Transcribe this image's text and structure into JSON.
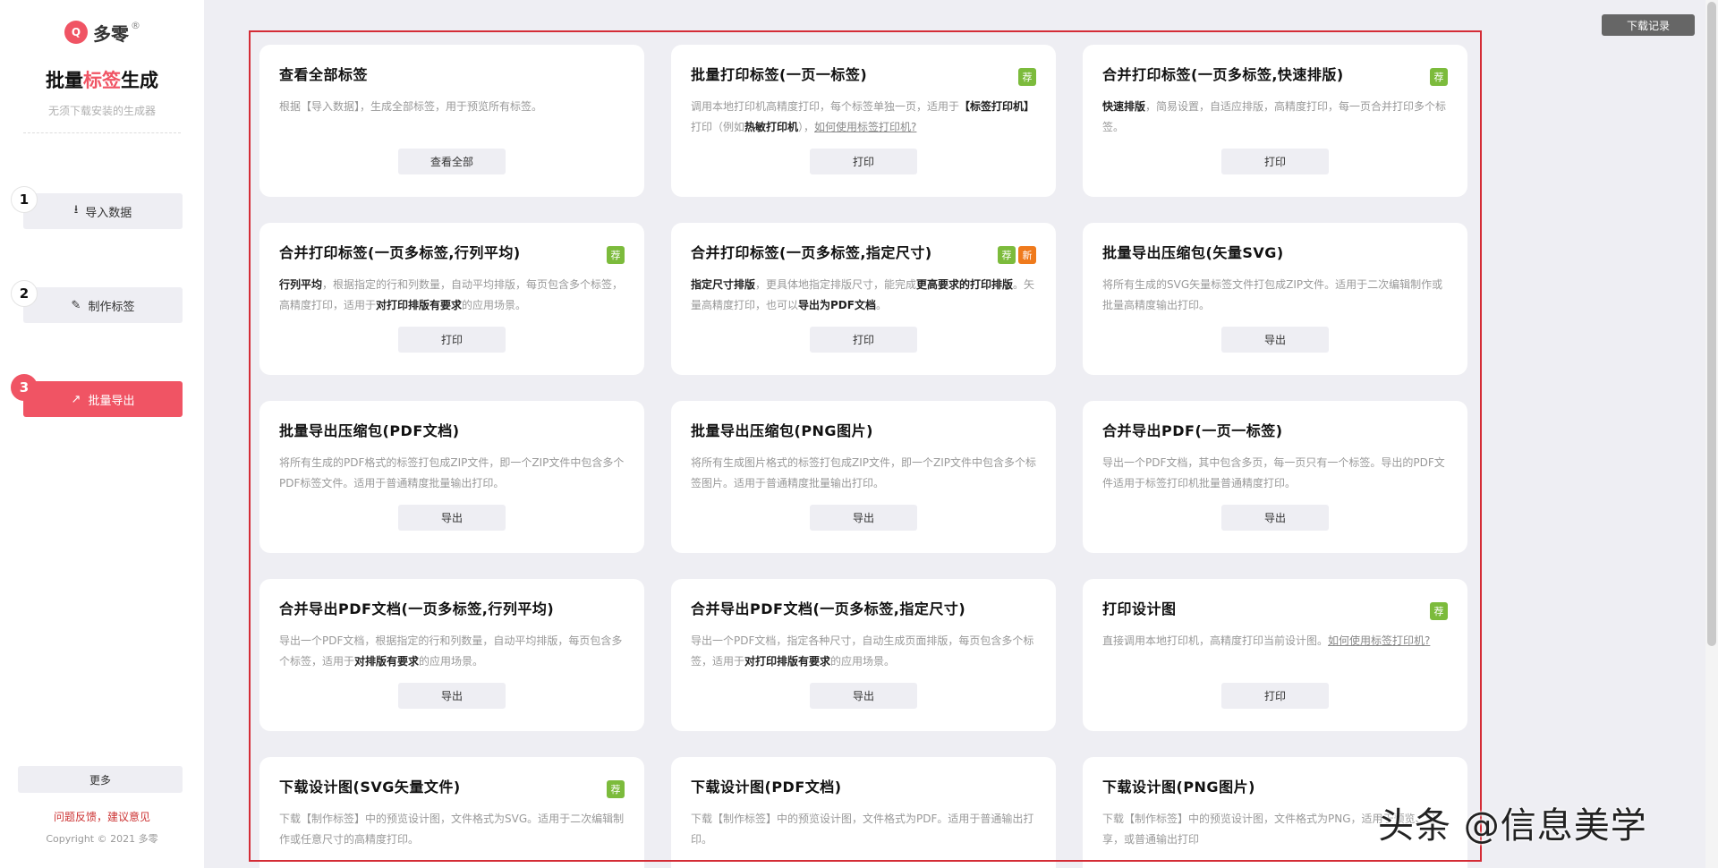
{
  "sidebar": {
    "logo_mark": "Q",
    "logo_text": "多零",
    "logo_reg": "®",
    "title_a": "批量",
    "title_b": "标签",
    "title_c": "生成",
    "subtitle": "无须下载安装的生成器",
    "steps": [
      {
        "num": "1",
        "label": "导入数据",
        "icon": "download-icon"
      },
      {
        "num": "2",
        "label": "制作标签",
        "icon": "edit-icon"
      },
      {
        "num": "3",
        "label": "批量导出",
        "icon": "export-icon",
        "active": true
      }
    ],
    "more": "更多",
    "feedback": "问题反馈，建议意见",
    "copyright": "Copyright © 2021 多零"
  },
  "header": {
    "download_records": "下载记录"
  },
  "colors": {
    "accent": "#f05464",
    "recommend": "#7cbb3c",
    "new": "#ef7a1c",
    "frame": "#d42c36"
  },
  "cards": [
    {
      "title": "查看全部标签",
      "badges": [],
      "desc": "根据【导入数据】，生成全部标签，用于预览所有标签。",
      "button": "查看全部"
    },
    {
      "title": "批量打印标签(一页一标签)",
      "badges": [
        "荐"
      ],
      "desc_html": [
        "调用本地打印机高精度打印，每个标签单独一页，适用于",
        "【标签打印机】",
        "打印（例如",
        "热敏打印机",
        "），",
        "如何使用标签打印机?"
      ],
      "button": "打印"
    },
    {
      "title": "合并打印标签(一页多标签,快速排版)",
      "badges": [
        "荐"
      ],
      "desc_parts": [
        "快速排版",
        "，简易设置，自适应排版，高精度打印，每一页合并打印多个标签。"
      ],
      "button": "打印"
    },
    {
      "title": "合并打印标签(一页多标签,行列平均)",
      "badges": [
        "荐"
      ],
      "desc_parts": [
        "行列平均",
        "，根据指定的行和列数量，自动平均排版，每页包含多个标签，高精度打印，适用于",
        "对打印排版有要求",
        "的应用场景。"
      ],
      "button": "打印"
    },
    {
      "title": "合并打印标签(一页多标签,指定尺寸)",
      "badges": [
        "荐",
        "新"
      ],
      "desc_parts": [
        "指定尺寸排版",
        "，更具体地指定排版尺寸，能完成",
        "更高要求的打印排版",
        "。矢量高精度打印，也可以",
        "导出为PDF文档",
        "。"
      ],
      "button": "打印"
    },
    {
      "title": "批量导出压缩包(矢量SVG)",
      "badges": [],
      "desc": "将所有生成的SVG矢量标签文件打包成ZIP文件。适用于二次编辑制作或批量高精度输出打印。",
      "button": "导出"
    },
    {
      "title": "批量导出压缩包(PDF文档)",
      "badges": [],
      "desc": "将所有生成的PDF格式的标签打包成ZIP文件，即一个ZIP文件中包含多个PDF标签文件。适用于普通精度批量输出打印。",
      "button": "导出"
    },
    {
      "title": "批量导出压缩包(PNG图片)",
      "badges": [],
      "desc": "将所有生成图片格式的标签打包成ZIP文件，即一个ZIP文件中包含多个标签图片。适用于普通精度批量输出打印。",
      "button": "导出"
    },
    {
      "title": "合并导出PDF(一页一标签)",
      "badges": [],
      "desc": "导出一个PDF文档，其中包含多页，每一页只有一个标签。导出的PDF文件适用于标签打印机批量普通精度打印。",
      "button": "导出"
    },
    {
      "title": "合并导出PDF文档(一页多标签,行列平均)",
      "badges": [],
      "desc_parts": [
        "导出一个PDF文档，根据指定的行和列数量，自动平均排版，每页包含多个标签，适用于",
        "对排版有要求",
        "的应用场景。"
      ],
      "button": "导出"
    },
    {
      "title": "合并导出PDF文档(一页多标签,指定尺寸)",
      "badges": [],
      "desc_parts": [
        "导出一个PDF文档，指定各种尺寸，自动生成页面排版，每页包含多个标签，适用于",
        "对打印排版有要求",
        "的应用场景。"
      ],
      "button": "导出"
    },
    {
      "title": "打印设计图",
      "badges": [
        "荐"
      ],
      "desc_link": [
        "直接调用本地打印机，高精度打印当前设计图。",
        "如何使用标签打印机?"
      ],
      "button": "打印"
    },
    {
      "title": "下载设计图(SVG矢量文件)",
      "badges": [
        "荐"
      ],
      "desc": "下载【制作标签】中的预览设计图，文件格式为SVG。适用于二次编辑制作或任意尺寸的高精度打印。",
      "button": ""
    },
    {
      "title": "下载设计图(PDF文档)",
      "badges": [],
      "desc": "下载【制作标签】中的预览设计图，文件格式为PDF。适用于普通输出打印。",
      "button": ""
    },
    {
      "title": "下载设计图(PNG图片)",
      "badges": [],
      "desc": "下载【制作标签】中的预览设计图，文件格式为PNG，适用于预览、分享，或普通输出打印",
      "button": ""
    }
  ],
  "watermark": "头条 @信息美学"
}
